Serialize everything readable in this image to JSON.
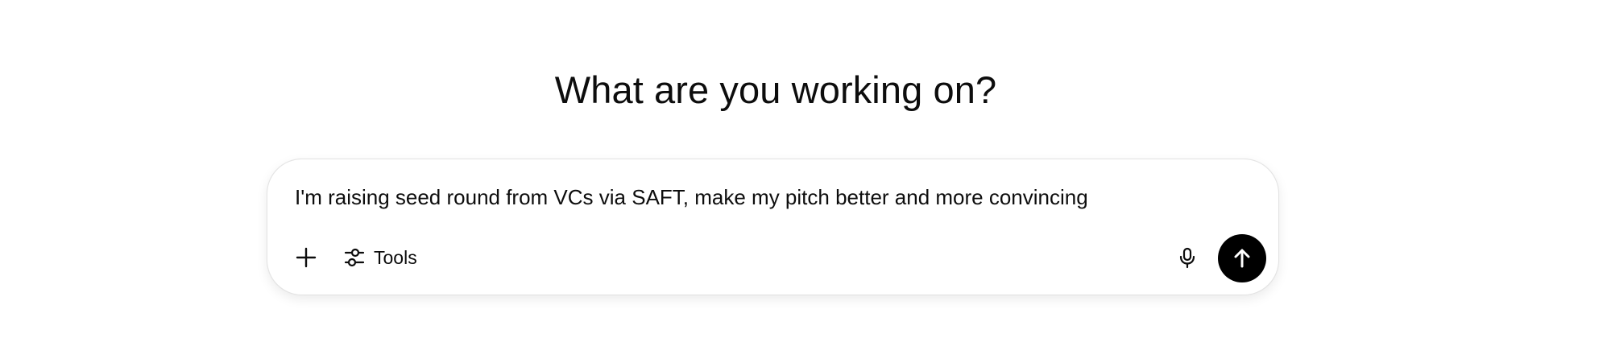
{
  "heading": "What are you working on?",
  "composer": {
    "prompt_text": "I'm raising seed round from VCs via SAFT, make my pitch better and more convincing",
    "tools_label": "Tools",
    "icons": {
      "add": "plus-icon",
      "tools": "sliders-icon",
      "voice": "microphone-icon",
      "send": "arrow-up-icon"
    },
    "colors": {
      "send_button": "#000000",
      "text": "#0d0d0d",
      "border": "#e3e3e3"
    }
  }
}
